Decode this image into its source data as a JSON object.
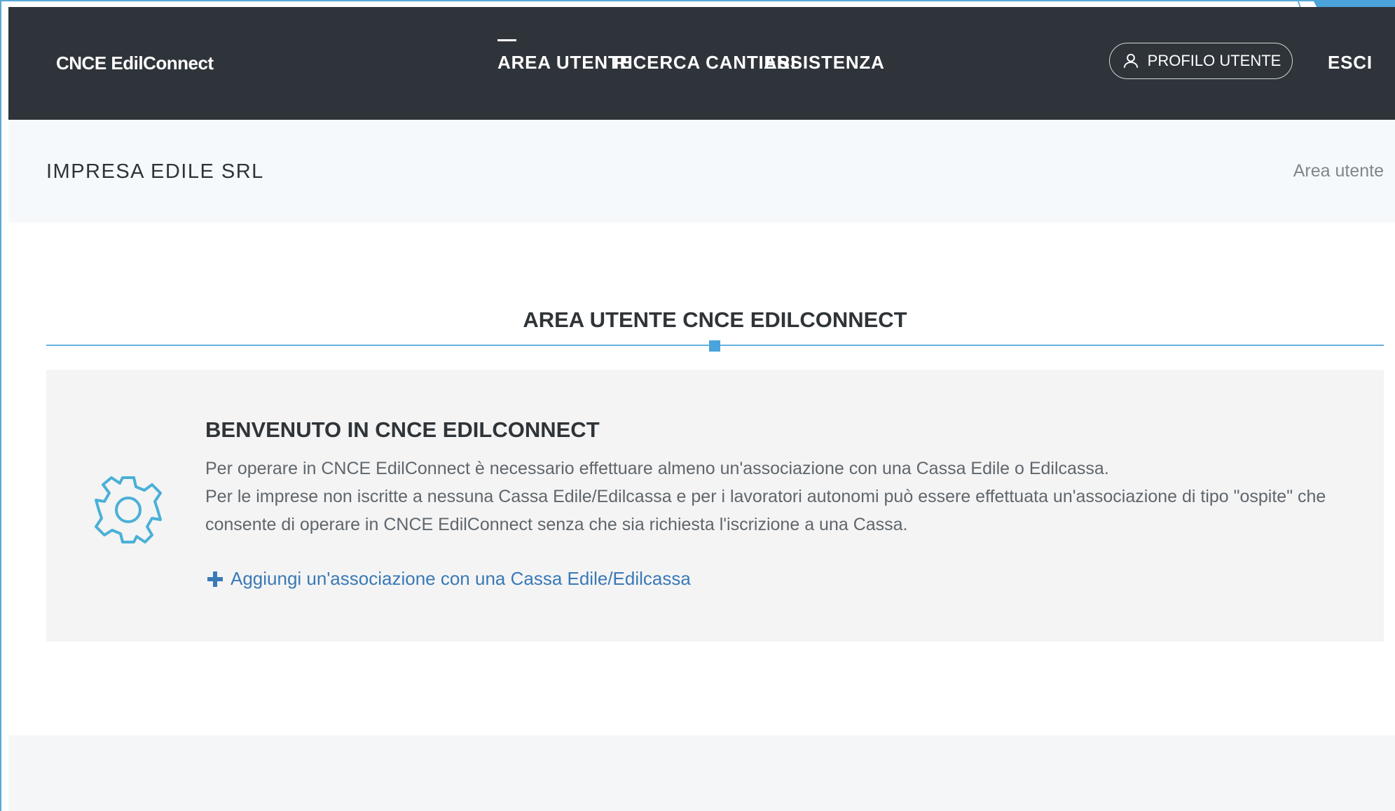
{
  "header": {
    "brand": "CNCE EdilConnect",
    "nav": [
      {
        "label": "AREA UTENTE",
        "active": true
      },
      {
        "label": "RICERCA CANTIERI",
        "active": false
      },
      {
        "label": "ASSISTENZA",
        "active": false
      }
    ],
    "profile_button": {
      "label": "PROFILO UTENTE",
      "icon": "user-icon"
    },
    "logout": "ESCI"
  },
  "subheader": {
    "company": "IMPRESA EDILE SRL",
    "breadcrumb": "Area utente"
  },
  "main": {
    "title": "AREA UTENTE CNCE EDILCONNECT",
    "welcome": {
      "icon": "gear-icon",
      "title": "BENVENUTO IN CNCE EDILCONNECT",
      "lines": [
        "Per operare in CNCE EdilConnect è necessario effettuare almeno un'associazione con una Cassa Edile o Edilcassa.",
        "Per le imprese non iscritte a nessuna Cassa Edile/Edilcassa e per i lavoratori autonomi può essere effettuata un'associazione di tipo \"ospite\" che",
        "consente di operare in CNCE EdilConnect senza che sia richiesta l'iscrizione a una Cassa."
      ],
      "add_link": {
        "label": "Aggiungi un'associazione con una Cassa Edile/Edilcassa",
        "icon": "plus-icon"
      }
    }
  },
  "colors": {
    "header_bg": "#2f343a",
    "accent": "#4aa3da",
    "link": "#3a79b6",
    "icon": "#4ab0d8"
  }
}
